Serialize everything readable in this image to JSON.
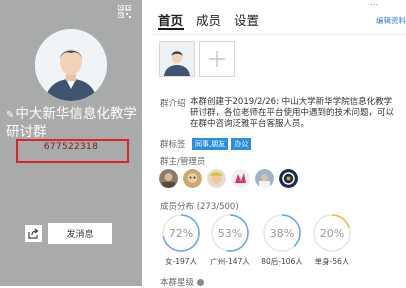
{
  "group": {
    "name": "中大新华信息化教学研讨群",
    "id": "677522318"
  },
  "left_actions": {
    "send_message": "发消息"
  },
  "tabs": [
    {
      "label": "首页",
      "active": true
    },
    {
      "label": "成员",
      "active": false
    },
    {
      "label": "设置",
      "active": false
    }
  ],
  "edit_profile": "编辑资料",
  "intro": {
    "label": "群介绍",
    "text": "本群创建于2019/2/26: 中山大学新华学院信息化教学研讨群，各位老师在平台使用中遇到的技术问题，可以在群中咨询泛雅平台客服人员。"
  },
  "tags": {
    "label": "群标签",
    "items": [
      "同事,朋友",
      "办公"
    ]
  },
  "admins": {
    "label": "群主/管理员",
    "count": 6
  },
  "distribution": {
    "label": "成员分布 (273/500)",
    "items": [
      {
        "percent": "72%",
        "value": 72,
        "caption": "女-197人",
        "color": "#6aa3e3"
      },
      {
        "percent": "53%",
        "value": 53,
        "caption": "广州-147人",
        "color": "#6aa3e3"
      },
      {
        "percent": "38%",
        "value": 38,
        "caption": "80后-106人",
        "color": "#6aa3e3"
      },
      {
        "percent": "20%",
        "value": 20,
        "caption": "单身-56人",
        "color": "#f2b63e"
      }
    ]
  },
  "level": {
    "label": "本群星级"
  },
  "colors": {
    "left_panel": "#a9aaaa",
    "accent": "#2c8fe0",
    "highlight_box": "#e02222"
  }
}
